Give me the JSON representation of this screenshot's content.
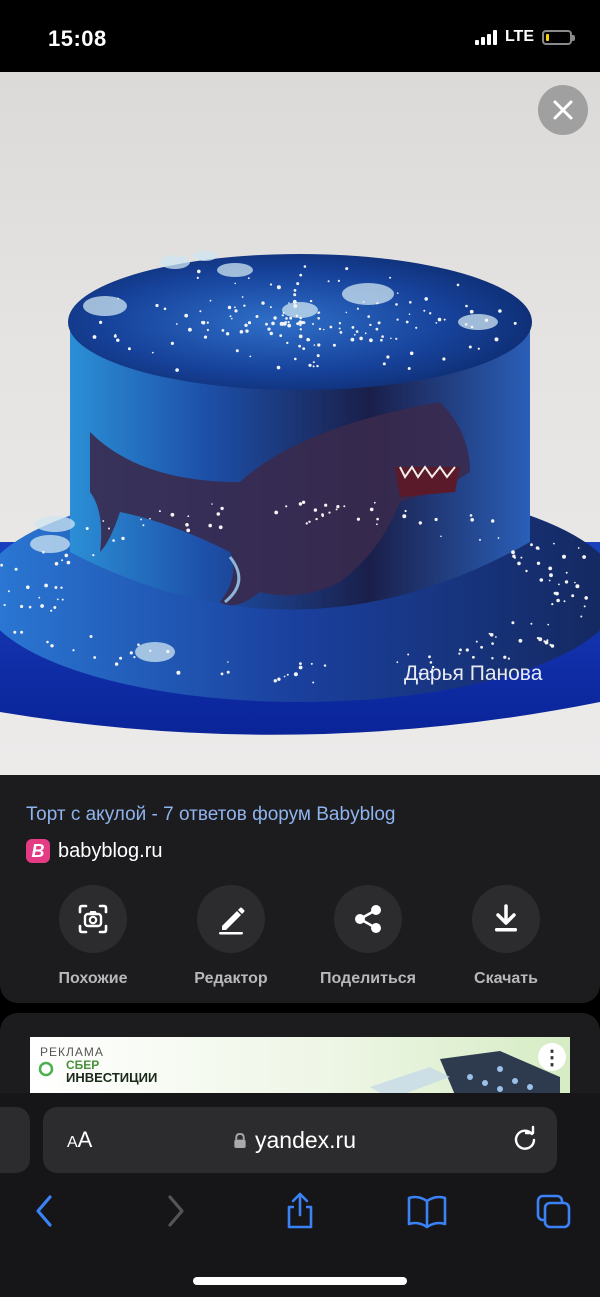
{
  "status_bar": {
    "time": "15:08",
    "network": "LTE",
    "battery_level": 0.15
  },
  "photo": {
    "watermark": "Дарья Панова"
  },
  "result": {
    "title": "Торт с акулой - 7 ответов форум Babyblog",
    "source_logo": "B",
    "source": "babyblog.ru"
  },
  "actions": [
    {
      "label": "Похожие",
      "icon": "camera-search-icon"
    },
    {
      "label": "Редактор",
      "icon": "pencil-icon"
    },
    {
      "label": "Поделиться",
      "icon": "share-icon"
    },
    {
      "label": "Скачать",
      "icon": "download-icon"
    }
  ],
  "ad": {
    "label": "РЕКЛАМА",
    "brand_line1": "СБЕР",
    "brand_line2": "ИНВЕСТИЦИИ",
    "more": "⋮"
  },
  "browser": {
    "text_size_small": "A",
    "text_size_large": "A",
    "url": "yandex.ru"
  },
  "colors": {
    "link": "#8fb3ee",
    "card_bg": "#1c1c1e",
    "button_bg": "#2c2c2e",
    "accent": "#3b82f6"
  }
}
